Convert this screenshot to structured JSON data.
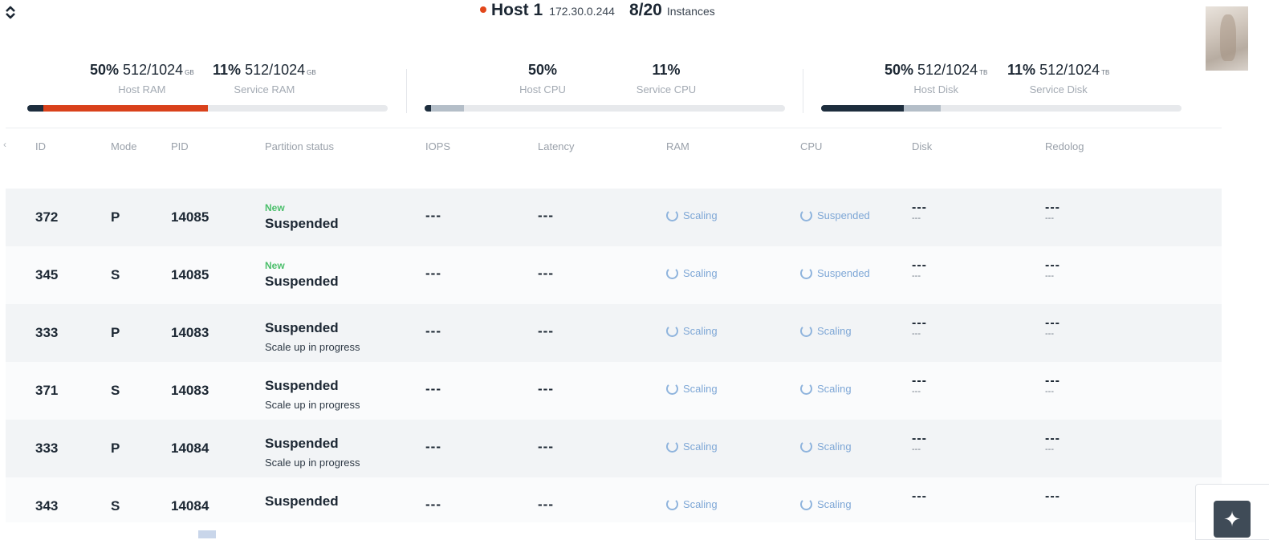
{
  "header": {
    "host_name": "Host 1",
    "host_ip": "172.30.0.244",
    "instances_count": "8/20",
    "instances_label": "Instances",
    "status_color": "#e2471a"
  },
  "metrics": {
    "host_ram": {
      "pct": "50%",
      "value": "512/1024",
      "unit": "GB",
      "label": "Host RAM",
      "fill": 0.5
    },
    "service_ram": {
      "pct": "11%",
      "value": "512/1024",
      "unit": "GB",
      "label": "Service RAM",
      "fill": 0.11
    },
    "host_cpu": {
      "pct": "50%",
      "label": "Host CPU",
      "fill": 0.5
    },
    "service_cpu": {
      "pct": "11%",
      "label": "Service CPU",
      "fill": 0.11
    },
    "host_disk": {
      "pct": "50%",
      "value": "512/1024",
      "unit": "TB",
      "label": "Host Disk",
      "fill": 0.5
    },
    "service_disk": {
      "pct": "11%",
      "value": "512/1024",
      "unit": "TB",
      "label": "Service Disk",
      "fill": 0.11
    }
  },
  "table": {
    "columns": [
      "ID",
      "Mode",
      "PID",
      "Partition status",
      "IOPS",
      "Latency",
      "RAM",
      "CPU",
      "Disk",
      "Redolog"
    ],
    "rows": [
      {
        "id": "372",
        "mode": "P",
        "pid": "14085",
        "tag": "New",
        "status": "Suspended",
        "sub": "",
        "iops": "---",
        "latency": "---",
        "ram": "Scaling",
        "cpu": "Suspended",
        "disk": "---",
        "disk_sub": "---",
        "redolog": "---",
        "redolog_sub": "---"
      },
      {
        "id": "345",
        "mode": "S",
        "pid": "14085",
        "tag": "New",
        "status": "Suspended",
        "sub": "",
        "iops": "---",
        "latency": "---",
        "ram": "Scaling",
        "cpu": "Suspended",
        "disk": "---",
        "disk_sub": "---",
        "redolog": "---",
        "redolog_sub": "---"
      },
      {
        "id": "333",
        "mode": "P",
        "pid": "14083",
        "tag": "",
        "status": "Suspended",
        "sub": "Scale up in progress",
        "iops": "---",
        "latency": "---",
        "ram": "Scaling",
        "cpu": "Scaling",
        "disk": "---",
        "disk_sub": "---",
        "redolog": "---",
        "redolog_sub": "---"
      },
      {
        "id": "371",
        "mode": "S",
        "pid": "14083",
        "tag": "",
        "status": "Suspended",
        "sub": "Scale up in progress",
        "iops": "---",
        "latency": "---",
        "ram": "Scaling",
        "cpu": "Scaling",
        "disk": "---",
        "disk_sub": "---",
        "redolog": "---",
        "redolog_sub": "---"
      },
      {
        "id": "333",
        "mode": "P",
        "pid": "14084",
        "tag": "",
        "status": "Suspended",
        "sub": "Scale up in progress",
        "iops": "---",
        "latency": "---",
        "ram": "Scaling",
        "cpu": "Scaling",
        "disk": "---",
        "disk_sub": "---",
        "redolog": "---",
        "redolog_sub": "---"
      },
      {
        "id": "343",
        "mode": "S",
        "pid": "14084",
        "tag": "",
        "status": "Suspended",
        "sub": "",
        "iops": "---",
        "latency": "---",
        "ram": "Scaling",
        "cpu": "Scaling",
        "disk": "---",
        "disk_sub": "",
        "redolog": "---",
        "redolog_sub": ""
      }
    ]
  },
  "icons": {
    "logo": "chevrons-icon",
    "assistant": "sparkle-icon",
    "status_spinner": "spinner-icon"
  },
  "colors": {
    "ram_bar": "#d9411b",
    "disk_bar": "#1d2d3d",
    "service_bar": "#b4bec8",
    "new_tag": "#4bbf6b",
    "scaling_text": "#7ea7d6"
  }
}
